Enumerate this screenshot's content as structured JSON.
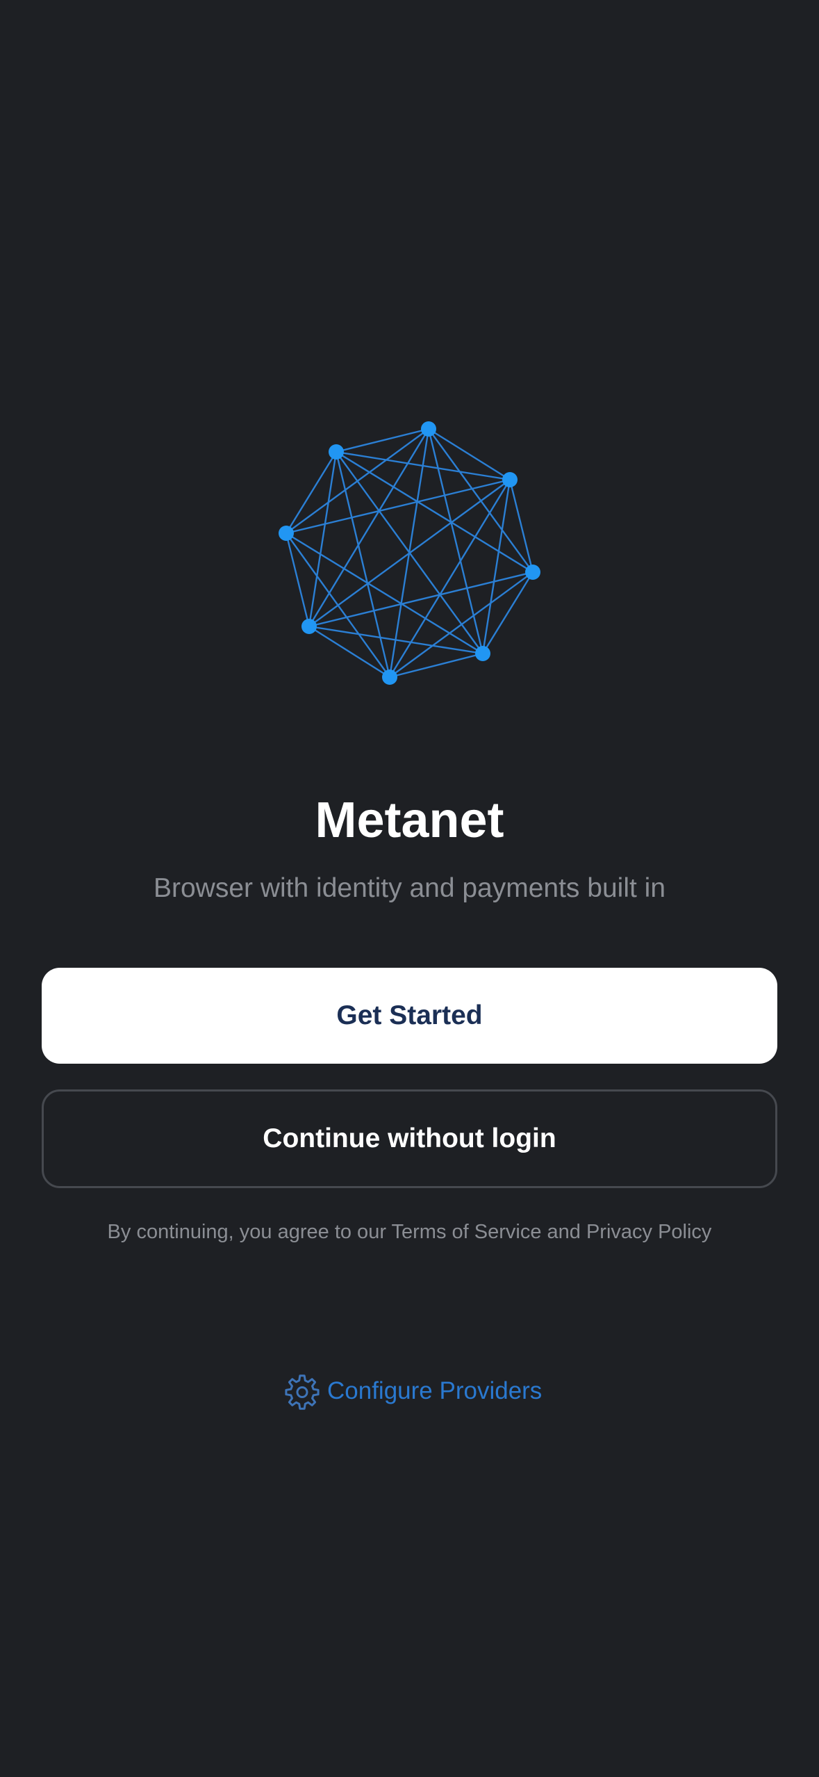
{
  "app": {
    "title": "Metanet",
    "subtitle": "Browser with identity and payments built in"
  },
  "logo": {
    "icon": "network-mesh-logo",
    "color": "#2196f3"
  },
  "actions": {
    "get_started_label": "Get Started",
    "continue_without_login_label": "Continue without login"
  },
  "legal": {
    "text": "By continuing, you agree to our Terms of Service and Privacy Policy"
  },
  "providers": {
    "icon": "gear-icon",
    "label": "Configure Providers",
    "color": "#2a79d0"
  },
  "theme": {
    "background": "#1e2024",
    "primary_button_bg": "#ffffff",
    "primary_button_text": "#1b2f55"
  }
}
